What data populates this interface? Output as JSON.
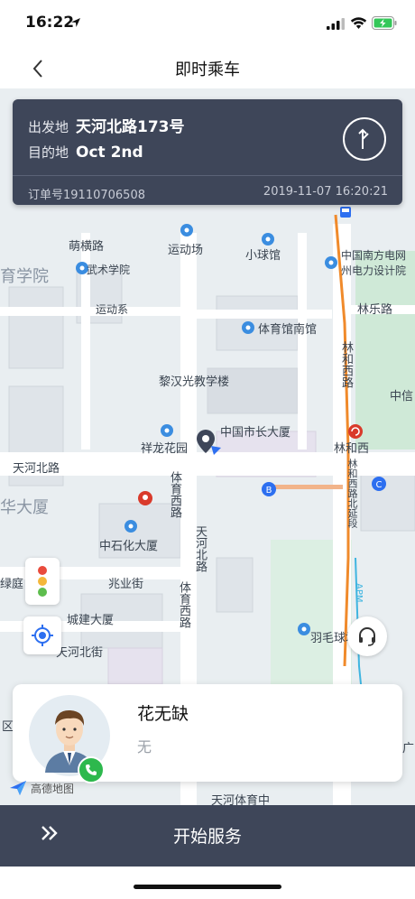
{
  "status_bar": {
    "time": "16:22"
  },
  "nav": {
    "title": "即时乘车"
  },
  "order": {
    "departure_label": "出发地",
    "departure_value": "天河北路173号",
    "destination_label": "目的地",
    "destination_value": "Oct 2nd",
    "order_number": "订单号19110706508",
    "datetime": "2019-11-07 16:20:21"
  },
  "map": {
    "labels": {
      "l1": "萌横路",
      "l2": "运动场",
      "l3": "小球馆",
      "l4": "中国南方电网",
      "l5": "州电力设计院",
      "l6": "育学院",
      "l7": "武术学院",
      "l8": "运动系",
      "l9": "林乐路",
      "l10": "体育馆南馆",
      "l11": "林和西路",
      "l12": "黎汉光教学楼",
      "l13": "中信",
      "l14": "中国市长大厦",
      "l15": "祥龙花园",
      "l16": "林和西",
      "l17": "天河北路",
      "l18": "体育西路",
      "l19": "华大厦",
      "l20": "中石化大厦",
      "l21": "兆业街",
      "l22": "天河北路",
      "l23": "城建大厦",
      "l24": "体育西路",
      "l25": "天河北街",
      "l26": "羽毛球场",
      "l27": "绿庭",
      "l28": "天河体育中",
      "l29": "林和西路北延段",
      "l30": "APM",
      "l31": "区",
      "l32": "广"
    }
  },
  "driver": {
    "name": "花无缺",
    "subtitle": "无"
  },
  "map_logo": "高德地图",
  "bottom": {
    "start_label": "开始服务"
  },
  "colors": {
    "dark": "#3e4659",
    "accent": "#2d6ff0",
    "phone": "#2db84d",
    "road_orange": "#f08a2b"
  }
}
